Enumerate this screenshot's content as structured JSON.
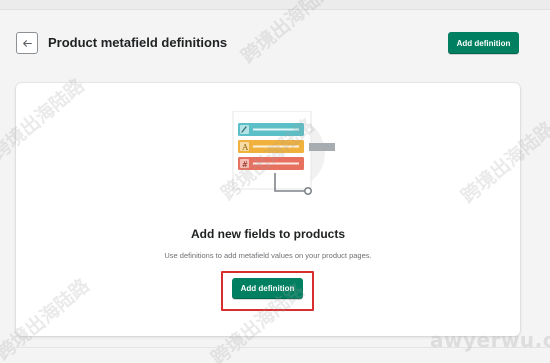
{
  "header": {
    "title": "Product metafield definitions",
    "add_button_label": "Add definition",
    "back_icon": "arrow-left-icon"
  },
  "empty_state": {
    "heading": "Add new fields to products",
    "description": "Use definitions to add metafield values on your product pages.",
    "button_label": "Add definition",
    "illustration_rows": [
      {
        "icon": "pencil-icon",
        "color": "#5bbfc8"
      },
      {
        "icon": "text-icon",
        "color": "#f0b13d"
      },
      {
        "icon": "hash-icon",
        "color": "#e8705f"
      }
    ]
  },
  "watermarks": {
    "text": "跨境出海陆路",
    "brand": "awyerwu.com"
  },
  "colors": {
    "primary": "#008060",
    "highlight": "#d92e2e",
    "background": "#f4f4f4"
  }
}
